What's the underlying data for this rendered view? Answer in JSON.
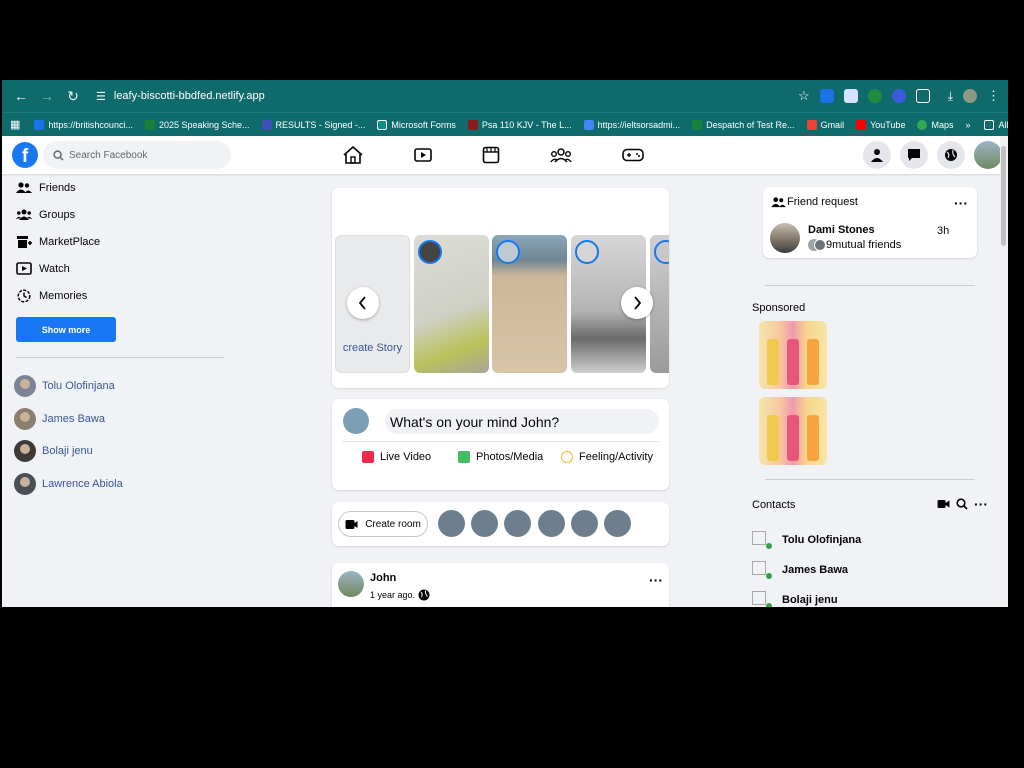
{
  "browser": {
    "url": "leafy-biscotti-bbdfed.netlify.app",
    "bookmarks": [
      {
        "label": "https://britishcounci...",
        "color": "#1a73e8"
      },
      {
        "label": "2025 Speaking Sche...",
        "color": "#188038"
      },
      {
        "label": "RESULTS - Signed -...",
        "color": "#3f51b5"
      },
      {
        "label": "Microsoft Forms",
        "color": "#0f8c8c"
      },
      {
        "label": "Psa 110 KJV - The L...",
        "color": "#8b1a1a"
      },
      {
        "label": "https://ieltsorsadmi...",
        "color": "#4285f4"
      },
      {
        "label": "Despatch of Test Re...",
        "color": "#188038"
      },
      {
        "label": "Gmail",
        "color": "#ea4335"
      },
      {
        "label": "YouTube",
        "color": "#ff0000"
      },
      {
        "label": "Maps",
        "color": "#34a853"
      }
    ],
    "all_bookmarks": "All Bookmarks"
  },
  "header": {
    "search_placeholder": "Search Facebook"
  },
  "sidebar": {
    "items": [
      {
        "label": "Friends",
        "icon": "friends-icon"
      },
      {
        "label": "Groups",
        "icon": "groups-icon"
      },
      {
        "label": "MarketPlace",
        "icon": "marketplace-icon"
      },
      {
        "label": "Watch",
        "icon": "watch-icon"
      },
      {
        "label": "Memories",
        "icon": "memories-icon"
      }
    ],
    "show_more": "Show more",
    "friends": [
      "Tolu Olofinjana",
      "James Bawa",
      "Bolaji jenu",
      "Lawrence Abiola"
    ]
  },
  "stories": {
    "create_label": "create Story"
  },
  "composer": {
    "prompt": "What's on your mind John?",
    "actions": [
      {
        "label": "Live Video",
        "color": "#f02849"
      },
      {
        "label": "Photos/Media",
        "color": "#45bd62"
      },
      {
        "label": "Feeling/Activity",
        "color": "#f7b928"
      }
    ]
  },
  "rooms": {
    "create_label": "Create room"
  },
  "post": {
    "author": "John",
    "time": "1 year ago."
  },
  "right": {
    "friend_request": {
      "title": "Friend request",
      "name": "Dami Stones",
      "time": "3h",
      "mutual": "9mutual friends"
    },
    "sponsored_title": "Sponsored",
    "contacts_title": "Contacts",
    "contacts": [
      "Tolu Olofinjana",
      "James Bawa",
      "Bolaji jenu"
    ]
  }
}
